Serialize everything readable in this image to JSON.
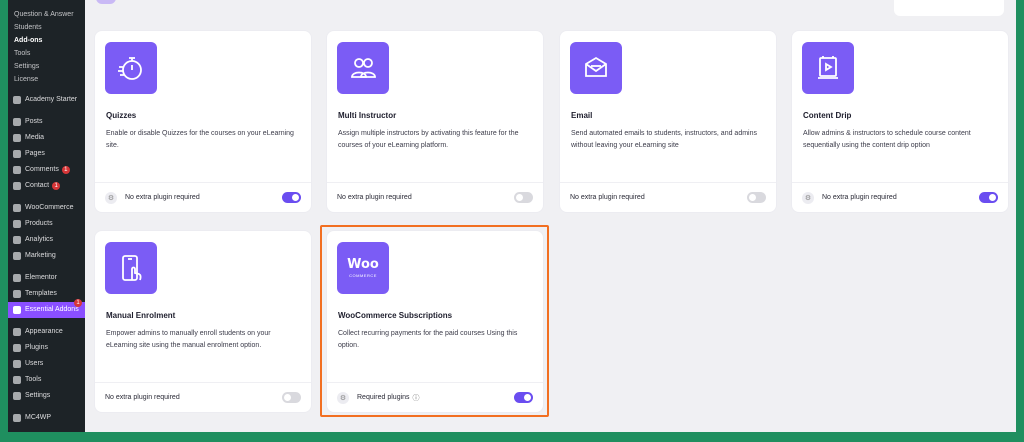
{
  "sidebar": {
    "sub_items": [
      {
        "label": "Question & Answer",
        "active": false
      },
      {
        "label": "Students",
        "active": false
      },
      {
        "label": "Add-ons",
        "active": true
      },
      {
        "label": "Tools",
        "active": false
      },
      {
        "label": "Settings",
        "active": false
      },
      {
        "label": "License",
        "active": false
      }
    ],
    "items": [
      {
        "label": "Academy Starter"
      },
      {
        "label": "Posts"
      },
      {
        "label": "Media"
      },
      {
        "label": "Pages"
      },
      {
        "label": "Comments",
        "badge": "1"
      },
      {
        "label": "Contact",
        "badge": "1"
      },
      {
        "label": "WooCommerce"
      },
      {
        "label": "Products"
      },
      {
        "label": "Analytics"
      },
      {
        "label": "Marketing"
      },
      {
        "label": "Elementor"
      },
      {
        "label": "Templates"
      },
      {
        "label": "Essential Addons",
        "badge": "1",
        "active": true
      },
      {
        "label": "Appearance"
      },
      {
        "label": "Plugins"
      },
      {
        "label": "Users"
      },
      {
        "label": "Tools"
      },
      {
        "label": "Settings"
      },
      {
        "label": "MC4WP"
      }
    ]
  },
  "addons": [
    {
      "title": "Quizzes",
      "description": "Enable or disable Quizzes for the courses on your eLearning site.",
      "footer": "No extra plugin required",
      "enabled": true,
      "icon": "stopwatch-icon"
    },
    {
      "title": "Multi Instructor",
      "description": "Assign multiple instructors by activating this feature for the courses of your eLearning platform.",
      "footer": "No extra plugin required",
      "enabled": false,
      "icon": "users-icon"
    },
    {
      "title": "Email",
      "description": "Send automated emails to students, instructors, and admins without leaving your eLearning site",
      "footer": "No extra plugin required",
      "enabled": false,
      "icon": "email-icon"
    },
    {
      "title": "Content Drip",
      "description": "Allow admins & instructors to schedule course content sequentially using the content drip option",
      "footer": "No extra plugin required",
      "enabled": true,
      "icon": "content-drip-icon"
    },
    {
      "title": "Manual Enrolment",
      "description": "Empower admins to manually enroll students on your eLearning site using the manual enrolment option.",
      "footer": "No extra plugin required",
      "enabled": false,
      "icon": "mobile-tap-icon"
    },
    {
      "title": "WooCommerce Subscriptions",
      "description": "Collect recurring payments for the paid courses Using this option.",
      "footer": "Required plugins",
      "enabled": true,
      "icon": "woocommerce-logo-icon",
      "logo_text": "Woo",
      "logo_subtext": "COMMERCE"
    }
  ],
  "colors": {
    "accent": "#7b5cf5",
    "toggle_on": "#6a4df0",
    "highlight": "#f26f21",
    "sidebar_active": "#8a4fff"
  }
}
